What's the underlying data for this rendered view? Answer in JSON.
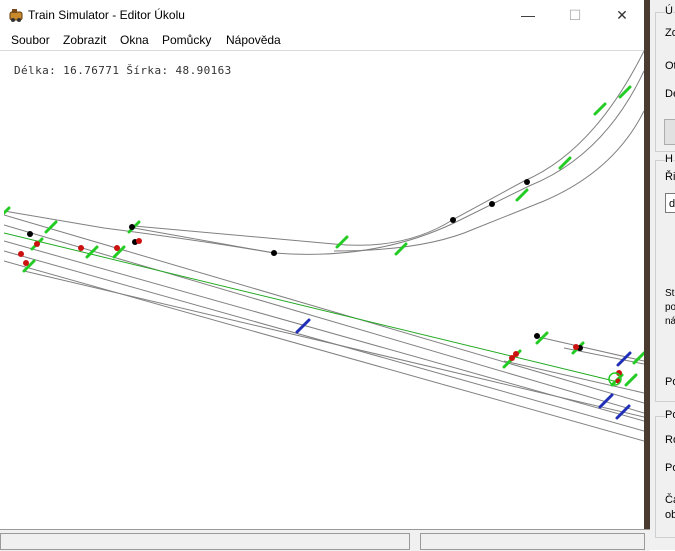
{
  "window": {
    "title": "Train Simulator - Editor Úkolu",
    "minimize_glyph": "—",
    "maximize_glyph": "☐",
    "close_glyph": "✕"
  },
  "menu": [
    "Soubor",
    "Zobrazit",
    "Okna",
    "Pomůcky",
    "Nápověda"
  ],
  "status": {
    "coords": "Délka: 16.76771 Šírka: 48.90163"
  },
  "colors": {
    "track": "#808080",
    "route": "#22aa22",
    "signal": "#22cc22",
    "marker_blue": "#1f2fb8",
    "node_black": "#000000",
    "node_red": "#cc1111"
  },
  "side_panel": {
    "groups": [
      {
        "title": "Ú"
      },
      {
        "title": "H"
      },
      {
        "title": "Po"
      }
    ],
    "labels": [
      "Zo",
      "Ot",
      "De",
      "Ři",
      "St",
      "po",
      "ná",
      "Po",
      "Ro",
      "Po",
      "Ča",
      "ob"
    ],
    "input_value": "d"
  }
}
